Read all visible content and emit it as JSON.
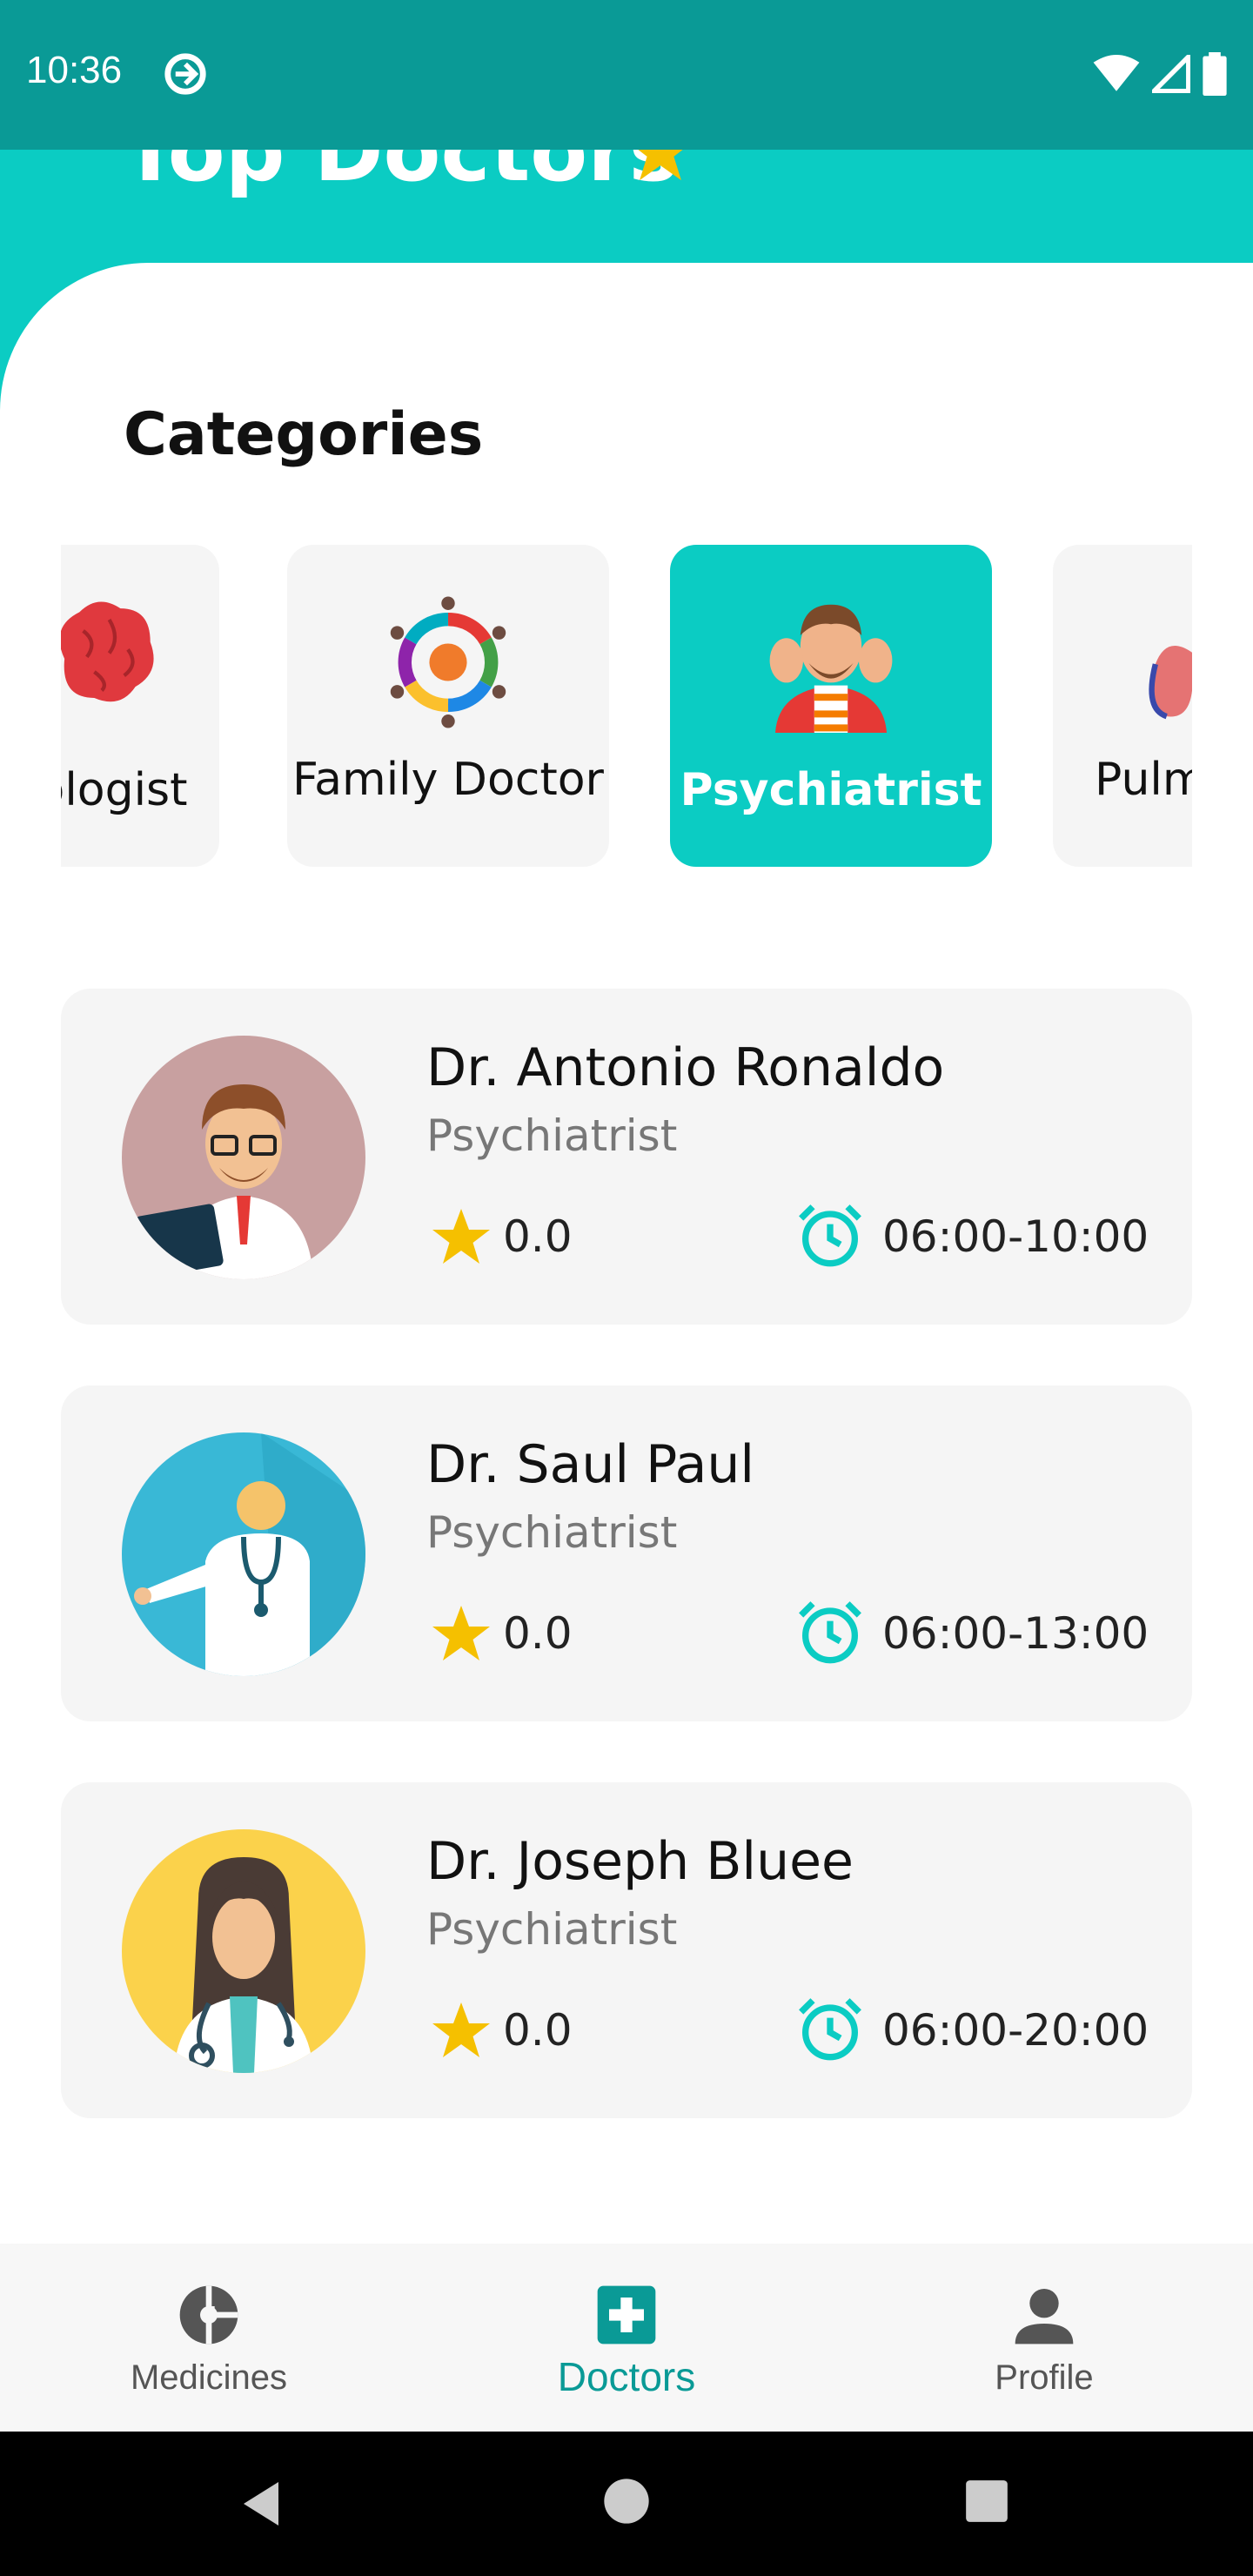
{
  "status_bar": {
    "time": "10:36"
  },
  "header": {
    "title": "Top Doctors"
  },
  "categories": {
    "title": "Categories",
    "items": [
      {
        "label": "Neurologist",
        "selected": false
      },
      {
        "label": "Family Doctor",
        "selected": false
      },
      {
        "label": "Psychiatrist",
        "selected": true
      },
      {
        "label": "Pulmonologist",
        "selected": false
      }
    ]
  },
  "doctors": [
    {
      "name": "Dr. Antonio Ronaldo",
      "specialty": "Psychiatrist",
      "rating": "0.0",
      "hours": "06:00-10:00"
    },
    {
      "name": "Dr. Saul Paul",
      "specialty": "Psychiatrist",
      "rating": "0.0",
      "hours": "06:00-13:00"
    },
    {
      "name": "Dr. Joseph Bluee",
      "specialty": "Psychiatrist",
      "rating": "0.0",
      "hours": "06:00-20:00"
    }
  ],
  "bottom_nav": {
    "items": [
      {
        "label": "Medicines",
        "icon": "pie-chart-icon",
        "active": false
      },
      {
        "label": "Doctors",
        "icon": "medical-cross-icon",
        "active": true
      },
      {
        "label": "Profile",
        "icon": "person-icon",
        "active": false
      }
    ]
  },
  "colors": {
    "accent": "#0bccc3",
    "status_bar": "#0a9a96",
    "star": "#f5c000",
    "card": "#f5f5f5"
  }
}
